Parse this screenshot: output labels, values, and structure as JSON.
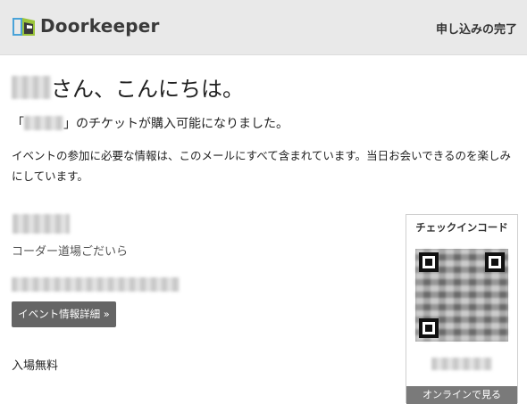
{
  "header": {
    "brand": "Doorkeeper",
    "status": "申し込みの完了"
  },
  "greeting": {
    "suffix": "さん、こんにちは。"
  },
  "ticket_notice": {
    "open_bracket": "「",
    "close_text": "」のチケットが購入可能になりました。"
  },
  "message": "イベントの参加に必要な情報は、このメールにすべて含まれています。当日お会いできるのを楽しみにしています。",
  "event": {
    "organizer": "コーダー道場ごだいら",
    "detail_button": "イベント情報詳細 »",
    "price": "入場無料"
  },
  "checkin": {
    "title": "チェックインコード",
    "online_button": "オンラインで見る"
  },
  "icons": {
    "logo": "doorkeeper-logo-icon"
  },
  "colors": {
    "header_bg": "#e9e9e9",
    "button_bg": "#656565",
    "logo_blue": "#4aa3d8",
    "logo_green": "#9bc43a"
  }
}
